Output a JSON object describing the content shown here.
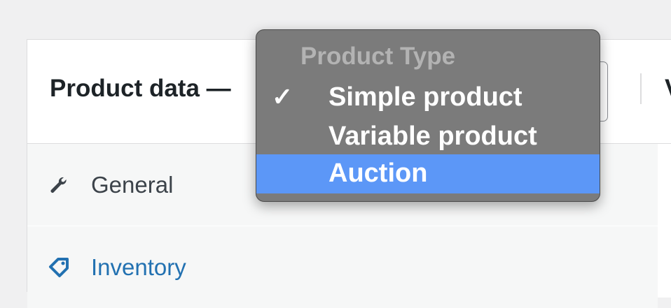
{
  "panel": {
    "title": "Product data —",
    "header_next_partial": "V"
  },
  "tabs": [
    {
      "label": "General",
      "icon": "wrench-icon",
      "color": "#3c434a"
    },
    {
      "label": "Inventory",
      "icon": "tag-icon",
      "color": "#2271b1"
    }
  ],
  "product_type_dropdown": {
    "heading": "Product Type",
    "options": [
      {
        "label": "Simple product",
        "checked": true,
        "highlighted": false
      },
      {
        "label": "Variable product",
        "checked": false,
        "highlighted": false
      },
      {
        "label": "Auction",
        "checked": false,
        "highlighted": true
      }
    ],
    "check_glyph": "✓",
    "highlight_color": "#5c97f7",
    "menu_bg_color": "#7b7b7b"
  }
}
